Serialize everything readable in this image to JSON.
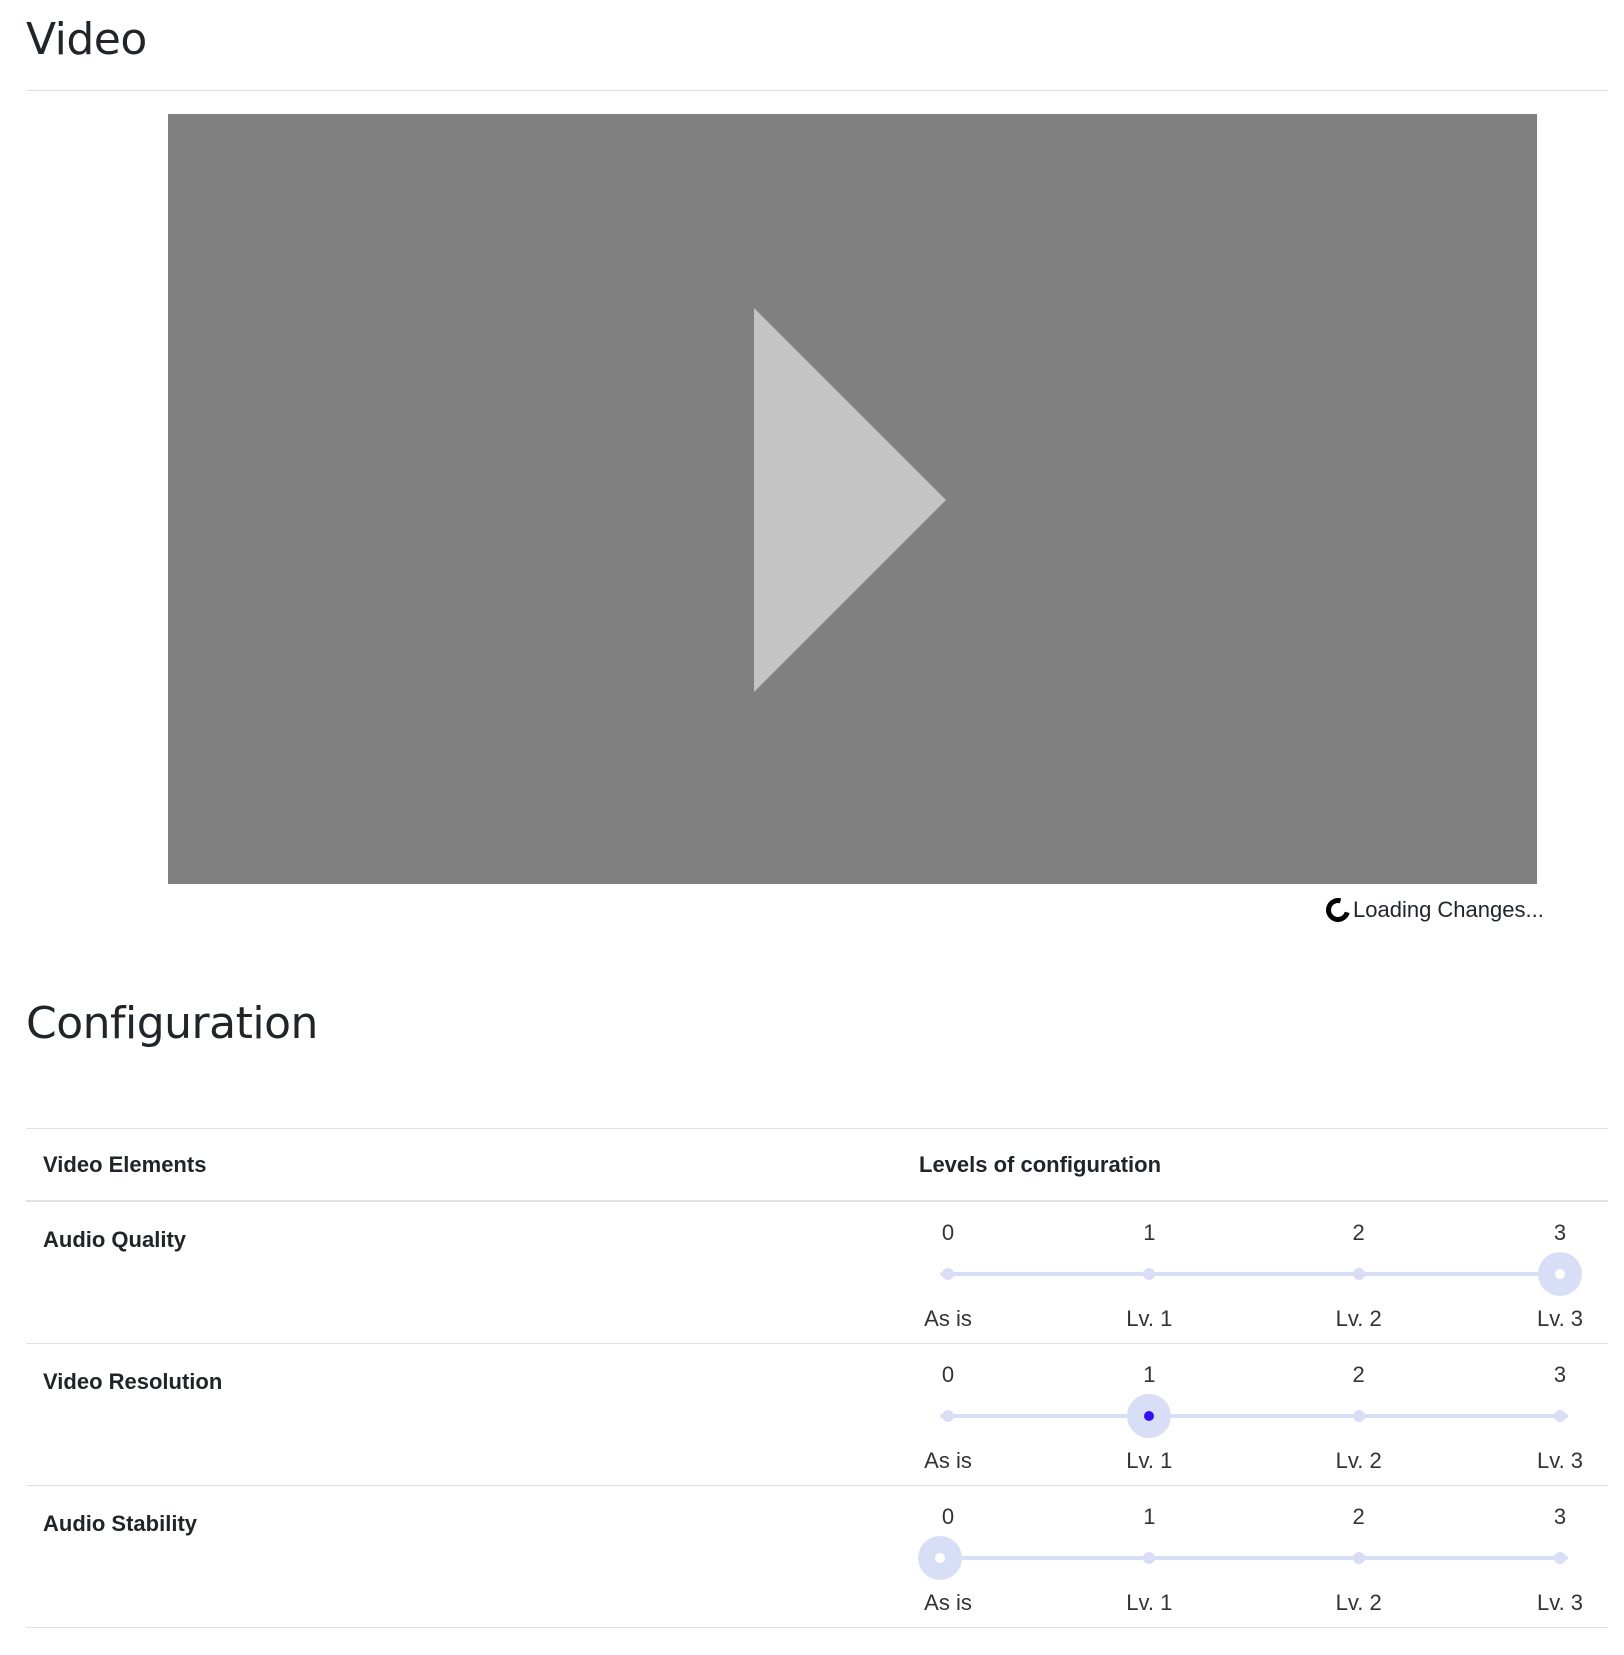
{
  "video_section": {
    "title": "Video",
    "loading_text": "Loading Changes..."
  },
  "config_section": {
    "title": "Configuration",
    "table": {
      "col_elements": "Video Elements",
      "col_levels": "Levels of configuration",
      "level_numbers": [
        "0",
        "1",
        "2",
        "3"
      ],
      "level_labels": [
        "As is",
        "Lv. 1",
        "Lv. 2",
        "Lv. 3"
      ],
      "rows": [
        {
          "label": "Audio Quality",
          "value": 3,
          "active": false
        },
        {
          "label": "Video Resolution",
          "value": 1,
          "active": true
        },
        {
          "label": "Audio Stability",
          "value": 0,
          "active": false
        }
      ]
    }
  },
  "colors": {
    "player_background": "#808080",
    "play_icon": "#c4c4c4",
    "slider_track": "#d8def5",
    "active_dot": "#3311ee"
  },
  "icons": {
    "play": "play-icon",
    "loading": "spinner-icon"
  }
}
